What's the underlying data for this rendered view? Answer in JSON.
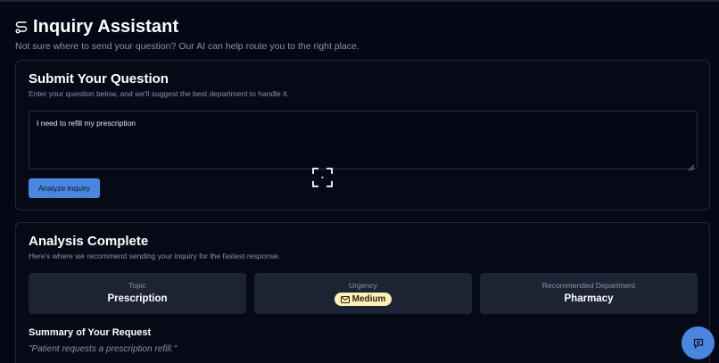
{
  "header": {
    "title": "Inquiry Assistant",
    "subtitle": "Not sure where to send your question? Our AI can help route you to the right place."
  },
  "submit": {
    "title": "Submit Your Question",
    "description": "Enter your question below, and we'll suggest the best department to handle it.",
    "question_value": "I need to refill my prescription",
    "analyze_label": "Analyze Inquiry"
  },
  "analysis": {
    "title": "Analysis Complete",
    "description": "Here's where we recommend sending your inquiry for the fastest response.",
    "topic_label": "Topic",
    "topic_value": "Prescription",
    "urgency_label": "Urgency",
    "urgency_value": "Medium",
    "department_label": "Recommended Department",
    "department_value": "Pharmacy",
    "summary_title": "Summary of Your Request",
    "summary_text": "\"Patient requests a prescription refill.\""
  },
  "icons": {
    "title": "route-icon",
    "urgency": "mail-icon",
    "focus": "focus-frame-icon",
    "chat": "chat-icon"
  },
  "colors": {
    "background": "#050814",
    "accent": "#4a86e0",
    "badge_bg": "#fdf1b8",
    "stat_bg": "#1c2434"
  }
}
